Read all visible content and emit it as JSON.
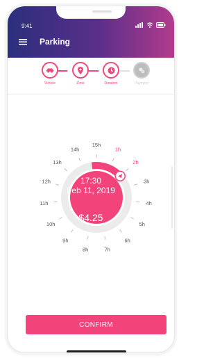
{
  "status": {
    "time": "9:41"
  },
  "header": {
    "title": "Parking"
  },
  "steps": [
    {
      "label": "Vehicle",
      "icon": "car-icon"
    },
    {
      "label": "Zone",
      "icon": "location-pin-icon"
    },
    {
      "label": "Duration",
      "icon": "clock-icon"
    },
    {
      "label": "Payment",
      "icon": "wallet-icon"
    }
  ],
  "dial": {
    "start_time": "17:30",
    "date": "Feb 11, 2019",
    "price": "$4.25",
    "selected_duration_hours": 2,
    "hours": [
      "15h",
      "1h",
      "2h",
      "3h",
      "4h",
      "5h",
      "6h",
      "7h",
      "8h",
      "9h",
      "10h",
      "11h",
      "12h",
      "13h",
      "14h"
    ]
  },
  "confirm": {
    "label": "CONFIRM"
  },
  "colors": {
    "accent": "#f2437a",
    "header_start": "#2b2f7d",
    "header_end": "#b23b8b"
  }
}
